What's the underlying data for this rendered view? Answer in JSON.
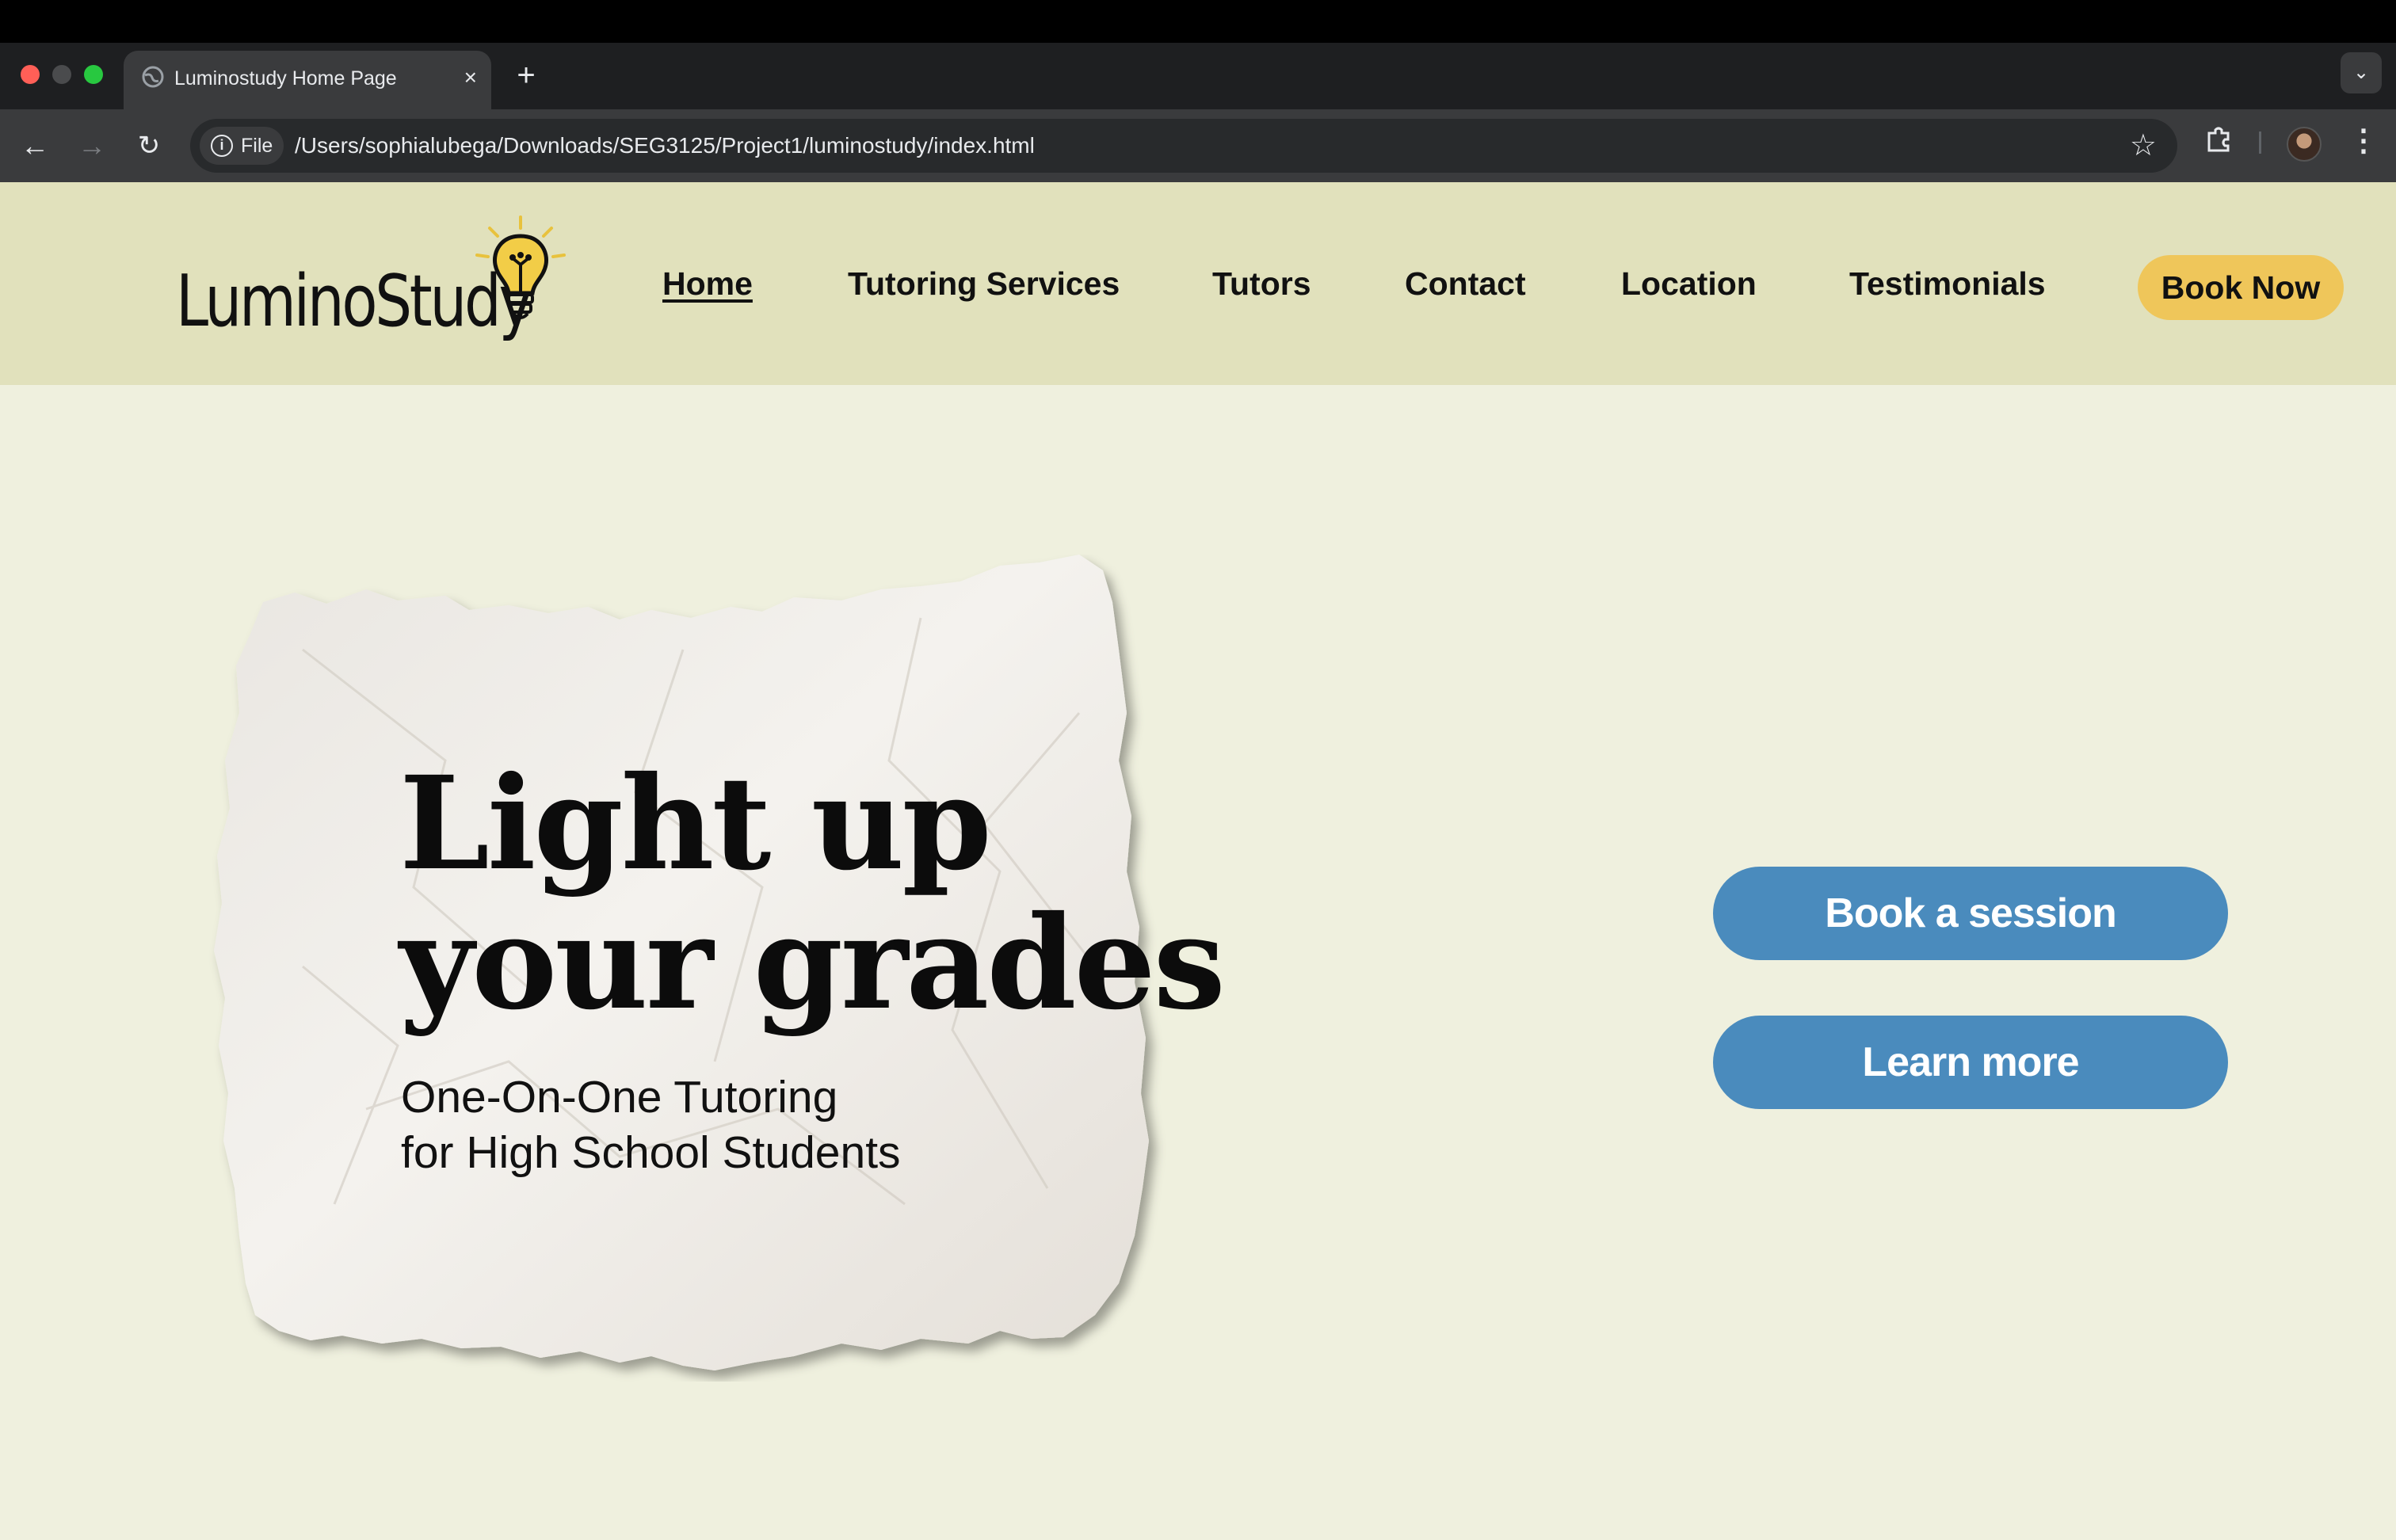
{
  "browser": {
    "tab_title": "Luminostudy Home Page",
    "tab_favicon": "globe-icon",
    "close_icon": "×",
    "new_tab_icon": "+",
    "tab_search_icon": "⌄",
    "back_icon": "←",
    "forward_icon": "→",
    "reload_icon": "↻",
    "chip_icon": "i",
    "chip_label": "File",
    "url": "/Users/sophialubega/Downloads/SEG3125/Project1/luminostudy/index.html",
    "star_icon": "☆",
    "extensions_icon": "⧉",
    "menu_icon": "⋮"
  },
  "header": {
    "logo_text": "LuminoStudy",
    "nav": [
      {
        "label": "Home",
        "active": true
      },
      {
        "label": "Tutoring Services"
      },
      {
        "label": "Tutors"
      },
      {
        "label": "Contact"
      },
      {
        "label": "Location"
      },
      {
        "label": "Testimonials"
      }
    ],
    "book_now_label": "Book Now"
  },
  "hero": {
    "headline_line1": "Light up",
    "headline_line2": "your grades",
    "subline_line1": "One-On-One Tutoring",
    "subline_line2": "for High School Students",
    "book_session_label": "Book a session",
    "learn_more_label": "Learn more"
  },
  "colors": {
    "page_bg": "#eff0de",
    "header_bg": "#e1e1bc",
    "book_now_bg": "#efc65a",
    "cta_bg": "#4a8bbd"
  }
}
